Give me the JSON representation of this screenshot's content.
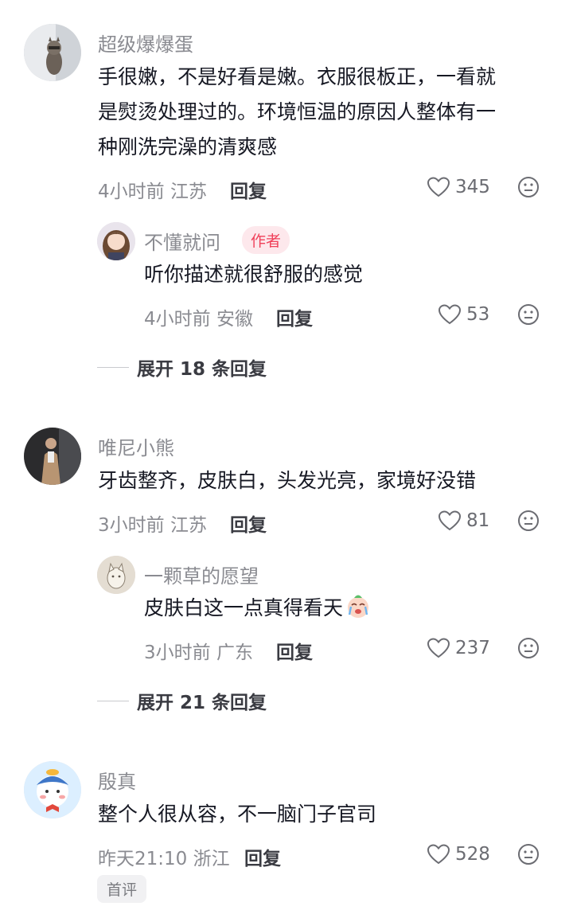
{
  "comments": [
    {
      "username": "超级爆爆蛋",
      "lines": [
        "手很嫩，不是好看是嫩。衣服很板正，一看就",
        "是熨烫处理过的。环境恒温的原因人整体有一",
        "种刚洗完澡的清爽感"
      ],
      "time": "4小时前 江苏",
      "reply_label": "回复",
      "likes": "345",
      "reply": {
        "username": "不懂就问",
        "badge": "作者",
        "text": "听你描述就很舒服的感觉",
        "time": "4小时前 安徽",
        "reply_label": "回复",
        "likes": "53"
      },
      "expand_label": "展开 18 条回复"
    },
    {
      "username": "唯尼小熊",
      "lines": [
        "牙齿整齐，皮肤白，头发光亮，家境好没错"
      ],
      "time": "3小时前 江苏",
      "reply_label": "回复",
      "likes": "81",
      "reply": {
        "username": "一颗草的愿望",
        "text": "皮肤白这一点真得看天",
        "emoji": "crying-face-emoji",
        "time": "3小时前 广东",
        "reply_label": "回复",
        "likes": "237"
      },
      "expand_label": "展开 21 条回复"
    },
    {
      "username": "殷真",
      "lines": [
        "整个人很从容，不一脑门子官司"
      ],
      "time": "昨天21:10 浙江",
      "reply_label": "回复",
      "likes": "528",
      "tag": "首评"
    }
  ],
  "icons": {
    "like": "heart-outline-icon",
    "dislike": "meh-face-icon"
  },
  "colors": {
    "author_badge_bg": "#fde8ec",
    "author_badge_text": "#f0415a",
    "meta": "#8a8b91"
  }
}
